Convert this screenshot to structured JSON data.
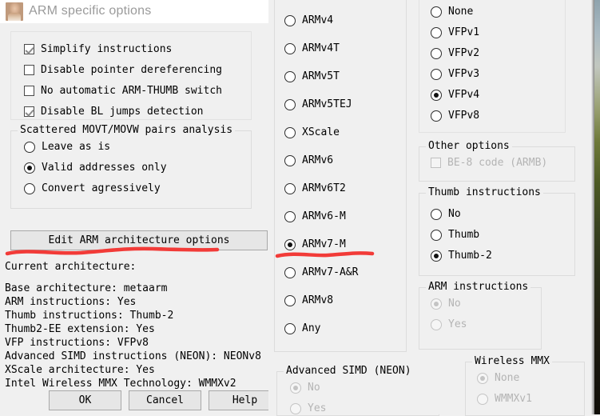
{
  "window": {
    "title": "ARM specific options",
    "icon": "app-photo-icon"
  },
  "left_dialog": {
    "options_checkboxes": [
      {
        "label": "Simplify instructions",
        "checked": true
      },
      {
        "label": "Disable pointer dereferencing",
        "checked": false
      },
      {
        "label": "No automatic ARM-THUMB switch",
        "checked": false
      },
      {
        "label": "Disable BL jumps detection",
        "checked": true
      }
    ],
    "scattered_group": {
      "legend": "Scattered MOVT/MOVW pairs analysis",
      "options": [
        {
          "label": "Leave as is",
          "selected": false
        },
        {
          "label": "Valid addresses only",
          "selected": true
        },
        {
          "label": "Convert agressively",
          "selected": false
        }
      ]
    },
    "edit_arch_button": "Edit ARM architecture options",
    "current_architecture_label": "Current architecture:",
    "architecture_lines": [
      "Base architecture: metaarm",
      "ARM instructions: Yes",
      "Thumb instructions: Thumb-2",
      "Thumb2-EE extension: Yes",
      "VFP instructions: VFPv8",
      "Advanced SIMD instructions (NEON): NEONv8",
      "XScale architecture: Yes",
      "Intel Wireless MMX Technology: WMMXv2"
    ],
    "buttons": [
      {
        "label": "OK"
      },
      {
        "label": "Cancel"
      },
      {
        "label": "Help"
      }
    ]
  },
  "middle_panel": {
    "architecture_options": [
      {
        "label": "ARMv4",
        "selected": false
      },
      {
        "label": "ARMv4T",
        "selected": false
      },
      {
        "label": "ARMv5T",
        "selected": false
      },
      {
        "label": "ARMv5TEJ",
        "selected": false
      },
      {
        "label": "XScale",
        "selected": false
      },
      {
        "label": "ARMv6",
        "selected": false
      },
      {
        "label": "ARMv6T2",
        "selected": false
      },
      {
        "label": "ARMv6-M",
        "selected": false
      },
      {
        "label": "ARMv7-M",
        "selected": true
      },
      {
        "label": "ARMv7-A&R",
        "selected": false
      },
      {
        "label": "ARMv8",
        "selected": false
      },
      {
        "label": "Any",
        "selected": false
      }
    ],
    "neon_group": {
      "legend": "Advanced SIMD (NEON)",
      "options": [
        {
          "label": "No",
          "selected": true,
          "disabled": true
        },
        {
          "label": "Yes",
          "selected": false,
          "disabled": true
        }
      ]
    }
  },
  "right_panel": {
    "vfp_options": [
      {
        "label": "None",
        "selected": false
      },
      {
        "label": "VFPv1",
        "selected": false
      },
      {
        "label": "VFPv2",
        "selected": false
      },
      {
        "label": "VFPv3",
        "selected": false
      },
      {
        "label": "VFPv4",
        "selected": true
      },
      {
        "label": "VFPv8",
        "selected": false
      }
    ],
    "other_options": {
      "legend": "Other options",
      "checkboxes": [
        {
          "label": "BE-8 code (ARMB)",
          "checked": false,
          "disabled": true
        }
      ]
    },
    "thumb_group": {
      "legend": "Thumb instructions",
      "options": [
        {
          "label": "No",
          "selected": false
        },
        {
          "label": "Thumb",
          "selected": false
        },
        {
          "label": "Thumb-2",
          "selected": true
        }
      ]
    },
    "arm_group": {
      "legend": "ARM instructions",
      "options": [
        {
          "label": "No",
          "selected": true,
          "disabled": true
        },
        {
          "label": "Yes",
          "selected": false,
          "disabled": true
        }
      ]
    },
    "wireless_mmx_group": {
      "legend": "Wireless MMX",
      "options": [
        {
          "label": "None",
          "selected": true,
          "disabled": true
        },
        {
          "label": "WMMXv1",
          "selected": false,
          "disabled": true
        }
      ]
    }
  },
  "annotations": {
    "underline_color": "#f23b38",
    "marks": [
      {
        "target": "edit-arm-architecture-options-button"
      },
      {
        "target": "radio-armv7-m"
      }
    ]
  }
}
